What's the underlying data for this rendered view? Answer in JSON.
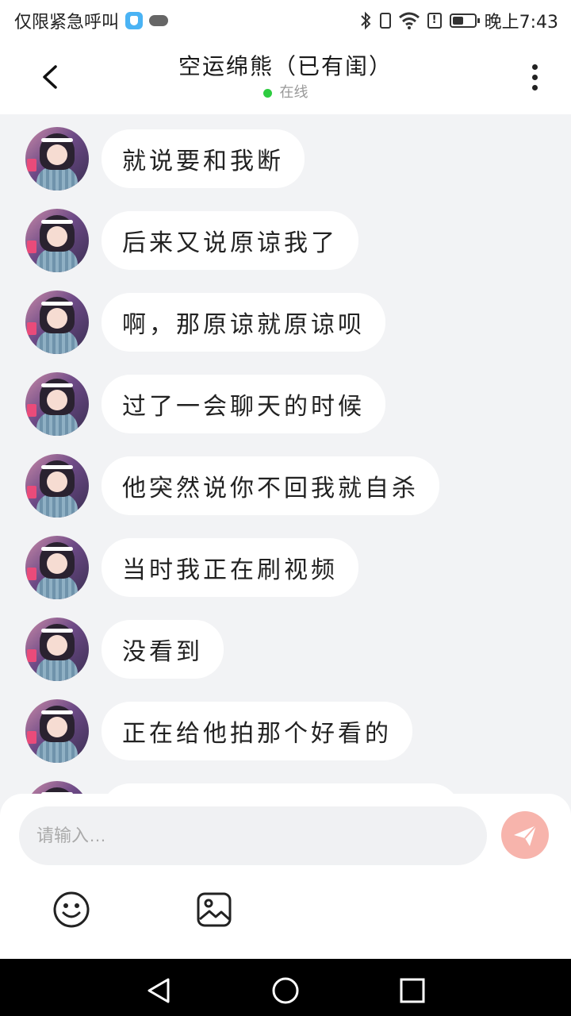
{
  "status_bar": {
    "left_text": "仅限紧急呼叫",
    "time": "晚上7:43",
    "icons": [
      "shield-icon",
      "cloud-icon",
      "bluetooth-icon",
      "vibrate-icon",
      "wifi-icon",
      "alert-icon",
      "battery-icon"
    ],
    "battery_level": 0.5
  },
  "header": {
    "title": "空运绵熊（已有闺）",
    "status": "在线",
    "status_color": "#2ecc40",
    "back_icon": "chevron-left-icon",
    "more_icon": "more-vertical-icon"
  },
  "messages": [
    "就说要和我断",
    "后来又说原谅我了",
    "啊，那原谅就原谅呗",
    "过了一会聊天的时候",
    "他突然说你不回我就自杀",
    "当时我正在刷视频",
    "没看到",
    "正在给他拍那个好看的"
  ],
  "input": {
    "placeholder": "请输入…",
    "value": "",
    "send_color": "#f7b4ac"
  },
  "toolbar": {
    "icons": [
      "emoji-icon",
      "image-icon"
    ]
  },
  "nav": {
    "icons": [
      "nav-back-icon",
      "nav-home-icon",
      "nav-recent-icon"
    ]
  }
}
